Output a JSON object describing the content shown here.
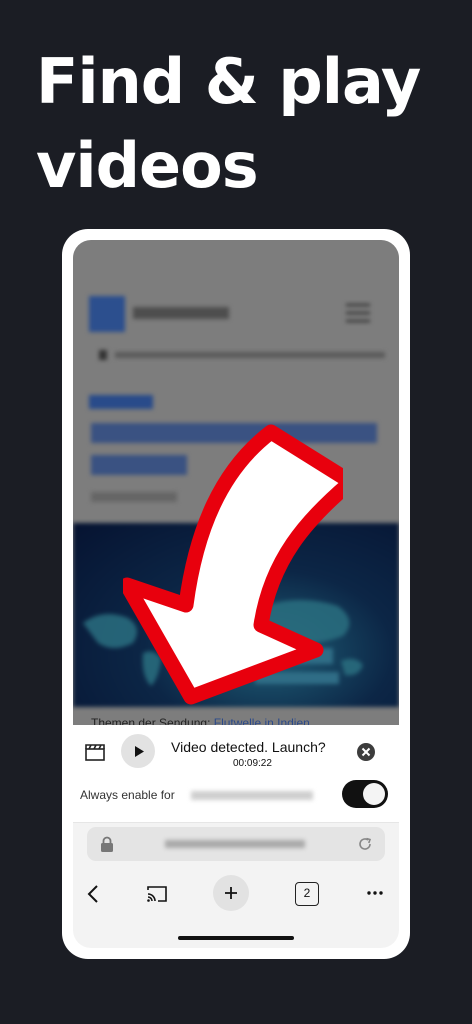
{
  "headline": {
    "line1": "Find & play",
    "line2": "videos"
  },
  "website": {
    "caption_prefix": "Themen der Sendung:",
    "caption_link": "Flutwelle in Indien"
  },
  "video_panel": {
    "message": "Video detected. Launch?",
    "duration": "00:09:22",
    "always_enable_label": "Always enable for",
    "toggle_on": true
  },
  "browser_nav": {
    "tab_count": "2"
  },
  "colors": {
    "arrow_fill": "#ffffff",
    "arrow_outline": "#e8000d",
    "background": "#1b1d24"
  },
  "icons": [
    "clapperboard-icon",
    "play-icon",
    "close-circle-icon",
    "lock-icon",
    "reload-icon",
    "back-icon",
    "cast-icon",
    "plus-icon",
    "tabs-icon",
    "more-icon"
  ]
}
